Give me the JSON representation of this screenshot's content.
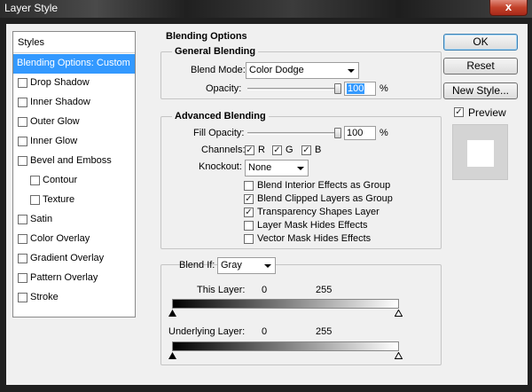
{
  "window": {
    "title": "Layer Style",
    "close_glyph": "x"
  },
  "styles_panel": {
    "header": "Styles",
    "selected": "Blending Options: Custom",
    "items": [
      {
        "label": "Drop Shadow",
        "checked": false,
        "indent": false
      },
      {
        "label": "Inner Shadow",
        "checked": false,
        "indent": false
      },
      {
        "label": "Outer Glow",
        "checked": false,
        "indent": false
      },
      {
        "label": "Inner Glow",
        "checked": false,
        "indent": false
      },
      {
        "label": "Bevel and Emboss",
        "checked": false,
        "indent": false
      },
      {
        "label": "Contour",
        "checked": false,
        "indent": true
      },
      {
        "label": "Texture",
        "checked": false,
        "indent": true
      },
      {
        "label": "Satin",
        "checked": false,
        "indent": false
      },
      {
        "label": "Color Overlay",
        "checked": false,
        "indent": false
      },
      {
        "label": "Gradient Overlay",
        "checked": false,
        "indent": false
      },
      {
        "label": "Pattern Overlay",
        "checked": false,
        "indent": false
      },
      {
        "label": "Stroke",
        "checked": false,
        "indent": false
      }
    ]
  },
  "blending_options": {
    "title": "Blending Options",
    "general": {
      "title": "General Blending",
      "blend_mode_label": "Blend Mode:",
      "blend_mode_value": "Color Dodge",
      "opacity_label": "Opacity:",
      "opacity_value": "100",
      "opacity_percent": 100,
      "percent_sign": "%"
    },
    "advanced": {
      "title": "Advanced Blending",
      "fill_opacity_label": "Fill Opacity:",
      "fill_opacity_value": "100",
      "fill_opacity_percent": 100,
      "percent_sign": "%",
      "channels_label": "Channels:",
      "channels": [
        {
          "label": "R",
          "checked": true
        },
        {
          "label": "G",
          "checked": true
        },
        {
          "label": "B",
          "checked": true
        }
      ],
      "knockout_label": "Knockout:",
      "knockout_value": "None",
      "options": [
        {
          "label": "Blend Interior Effects as Group",
          "checked": false
        },
        {
          "label": "Blend Clipped Layers as Group",
          "checked": true
        },
        {
          "label": "Transparency Shapes Layer",
          "checked": true
        },
        {
          "label": "Layer Mask Hides Effects",
          "checked": false
        },
        {
          "label": "Vector Mask Hides Effects",
          "checked": false
        }
      ]
    },
    "blend_if": {
      "label": "Blend If:",
      "value": "Gray",
      "this_layer": {
        "label": "This Layer:",
        "low": "0",
        "high": "255"
      },
      "underlying_layer": {
        "label": "Underlying Layer:",
        "low": "0",
        "high": "255"
      }
    }
  },
  "buttons": {
    "ok": "OK",
    "reset": "Reset",
    "new_style": "New Style..."
  },
  "preview": {
    "label": "Preview",
    "checked": true
  },
  "colors": {
    "selection": "#3399ff",
    "close_red": "#c2412a"
  }
}
